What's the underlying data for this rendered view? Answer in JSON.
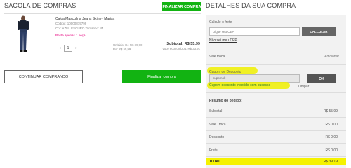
{
  "bag": {
    "title": "SACOLA DE COMPRAS",
    "finalize_top_label": "FINALIZAR COMPRA",
    "product": {
      "name": "Calça Masculina Jeans Skinny Marisa",
      "code": "Código: 10000879799",
      "attributes": "Cor: AZUL ESCURO  Tamanho: 44",
      "stock_note": "Resta apenas 1 peça",
      "quantity": "1",
      "unit_label": "Unitário:",
      "unit_old_price": "De R$ 89,90",
      "unit_new_price": "Por R$ 55,99",
      "subtotal": "Subtotal: R$ 55,99",
      "savings": "Você economizou: R$ 33,91"
    },
    "continue_label": "CONTINUAR COMPRANDO",
    "finalize_label": "Finalizar compra"
  },
  "summary": {
    "title": "DETALHES DA SUA COMPRA",
    "shipping_label": "Calcule o frete",
    "cep_placeholder": "Digite seu CEP",
    "calc_button": "CALCULAR",
    "no_cep_link": "Não sei meu CEP",
    "vale_label": "Vale troca",
    "vale_add": "Adicionar",
    "coupon_label": "Cupom de Desconto",
    "coupon_value": "cupomok",
    "ok_button": "OK",
    "coupon_success": "Cupom desconto inserido com sucesso",
    "clear_link": "Limpar",
    "resume_title": "Resumo do pedido:",
    "rows": [
      {
        "label": "Subtotal",
        "value": "R$ 55,99"
      },
      {
        "label": "Vale Troca",
        "value": "R$ 0,00"
      },
      {
        "label": "Desconto",
        "value": "R$ 0,00"
      },
      {
        "label": "Frete",
        "value": "R$ 0,00"
      }
    ],
    "total_label": "TOTAL",
    "total_value": "R$ 39,19"
  },
  "colors": {
    "green": "#12b312",
    "highlight": "#f5f200",
    "panel": "#f2f2f2"
  }
}
